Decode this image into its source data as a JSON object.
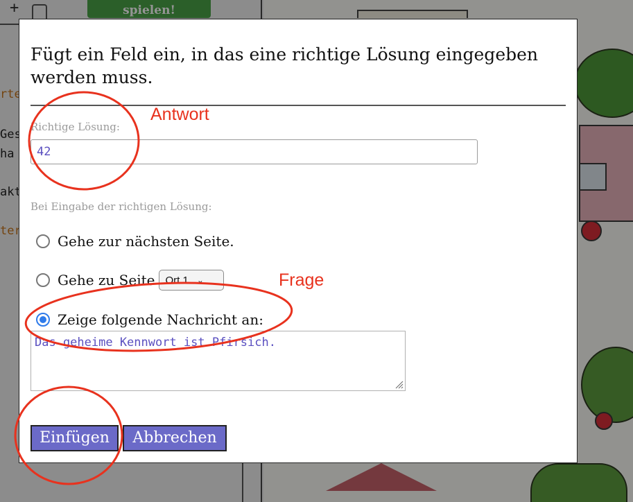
{
  "background": {
    "play_button": "spielen!",
    "plus": "+",
    "fragments": [
      "rte",
      "Ges",
      "ha",
      "akt",
      "ter"
    ]
  },
  "dialog": {
    "title": "Fügt ein Feld ein, in das eine richtige Lösung eingegeben werden muss.",
    "answer": {
      "label": "Richtige Lösung:",
      "value": "42"
    },
    "action_label": "Bei Eingabe der richtigen Lösung:",
    "options": [
      {
        "label": "Gehe zur nächsten Seite.",
        "checked": false
      },
      {
        "label": "Gehe zu Seite",
        "checked": false,
        "select_value": "Ort 1"
      },
      {
        "label": "Zeige folgende Nachricht an:",
        "checked": true
      }
    ],
    "message": "Das geheime Kennwort ist Pfirsich.",
    "buttons": {
      "insert": "Einfügen",
      "cancel": "Abbrechen"
    }
  },
  "annotations": {
    "answer": "Antwort",
    "question": "Frage",
    "color": "#e8321e"
  },
  "colors": {
    "accent": "#6b6ac8",
    "radio_checked": "#2f7bea",
    "input_text": "#5a4fc0"
  }
}
